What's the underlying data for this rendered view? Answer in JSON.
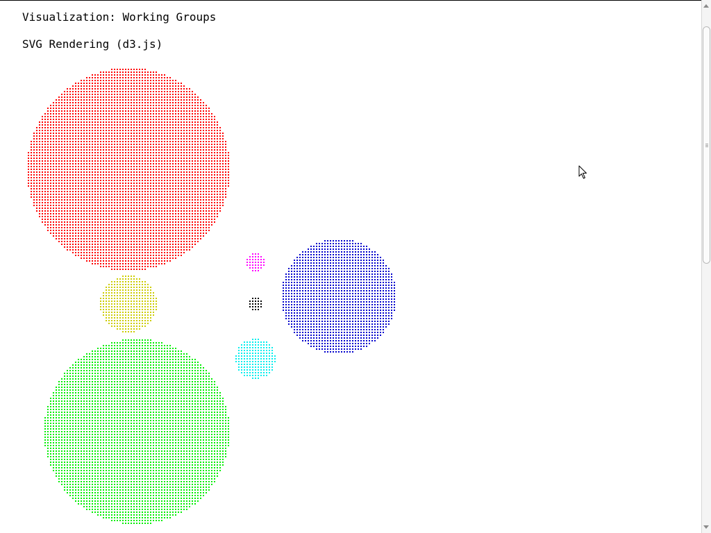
{
  "page": {
    "heading": "Visualization: Working Groups",
    "subheading": "SVG Rendering (d3.js)"
  },
  "visualization": {
    "renderer": "SVG",
    "mark": "dot",
    "groups": [
      {
        "name": "red-group",
        "color": "#ff0000"
      },
      {
        "name": "yellow-group",
        "color": "#cccc00"
      },
      {
        "name": "green-group",
        "color": "#00ee00"
      },
      {
        "name": "magenta-group",
        "color": "#ff00ff"
      },
      {
        "name": "black-group",
        "color": "#000000"
      },
      {
        "name": "cyan-group",
        "color": "#00eeee"
      },
      {
        "name": "blue-group",
        "color": "#0000cc"
      }
    ]
  },
  "icons": {
    "cursor": "mouse-pointer-icon"
  }
}
